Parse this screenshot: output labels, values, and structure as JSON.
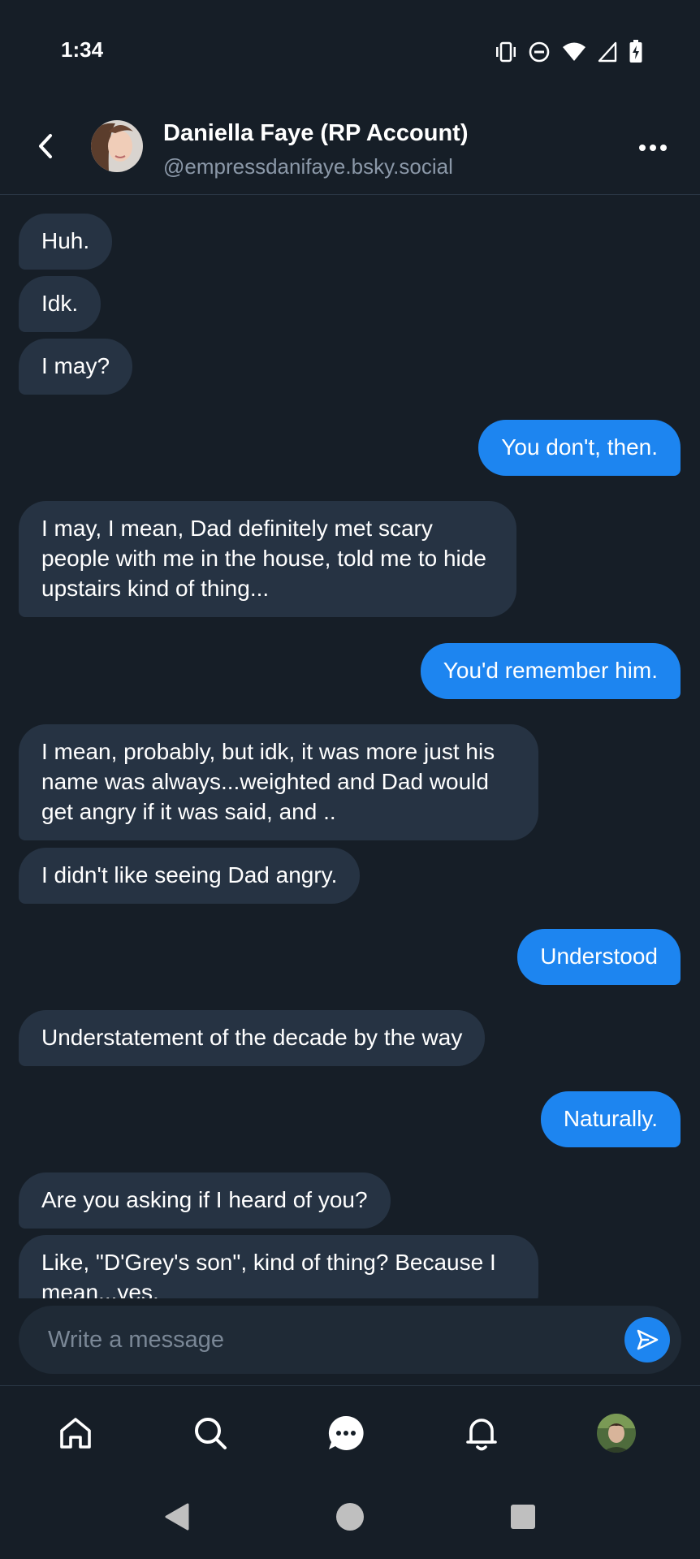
{
  "status_bar": {
    "time": "1:34",
    "icons": [
      "vibrate-icon",
      "do-not-disturb-icon",
      "wifi-icon",
      "cell-signal-icon",
      "battery-charging-icon"
    ]
  },
  "header": {
    "peer_name": "Daniella Faye (RP Account)",
    "peer_handle": "@empressdanifaye.bsky.social"
  },
  "messages": [
    {
      "dir": "in",
      "text": "Huh."
    },
    {
      "dir": "in",
      "text": "Idk."
    },
    {
      "dir": "in",
      "text": "I may?"
    },
    {
      "dir": "out",
      "text": "You don't, then."
    },
    {
      "dir": "in",
      "text": "I may, I mean, Dad definitely met scary people with me in the house, told me to hide upstairs kind of thing..."
    },
    {
      "dir": "out",
      "text": "You'd remember him."
    },
    {
      "dir": "in",
      "text": "I mean, probably, but idk, it was more just his name was always...weighted and Dad would get angry if it was said, and .."
    },
    {
      "dir": "in",
      "text": "I didn't like seeing Dad angry."
    },
    {
      "dir": "out",
      "text": "Understood"
    },
    {
      "dir": "in",
      "text": "Understatement of the decade by the way"
    },
    {
      "dir": "out",
      "text": "Naturally."
    },
    {
      "dir": "in",
      "text": "Are you asking if I heard of you?"
    },
    {
      "dir": "in",
      "text": "Like, \"D'Grey's son\", kind of thing? Because I mean...yes."
    }
  ],
  "composer": {
    "placeholder": "Write a message",
    "value": ""
  },
  "bottom_nav": [
    "home-icon",
    "search-icon",
    "chat-icon",
    "notifications-bell-icon",
    "profile-avatar"
  ],
  "colors": {
    "background": "#161e27",
    "incoming_bubble": "#263343",
    "outgoing_bubble": "#1d85f0",
    "accent": "#1d85f0",
    "secondary_text": "#8b98a8"
  }
}
